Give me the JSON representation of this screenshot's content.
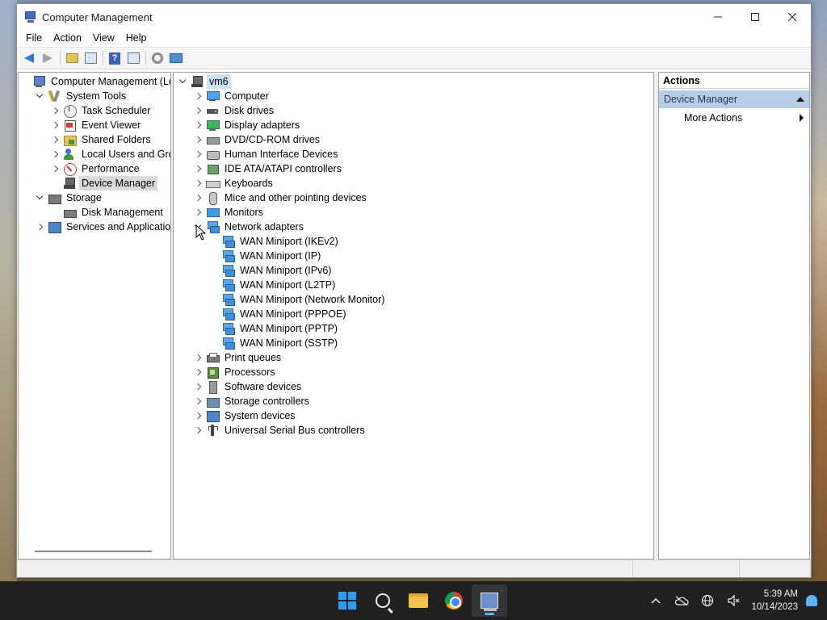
{
  "window": {
    "title": "Computer Management"
  },
  "menu": [
    "File",
    "Action",
    "View",
    "Help"
  ],
  "nav_tree": [
    {
      "name": "root",
      "label": "Computer Management (Local",
      "level": 0,
      "expander": "none",
      "icon": "computer-management-icon"
    },
    {
      "name": "system-tools",
      "label": "System Tools",
      "level": 1,
      "expander": "down",
      "icon": "tools-icon"
    },
    {
      "name": "task-scheduler",
      "label": "Task Scheduler",
      "level": 2,
      "expander": "right",
      "icon": "clock-icon"
    },
    {
      "name": "event-viewer",
      "label": "Event Viewer",
      "level": 2,
      "expander": "right",
      "icon": "event-viewer-icon"
    },
    {
      "name": "shared-folders",
      "label": "Shared Folders",
      "level": 2,
      "expander": "right",
      "icon": "shared-folder-icon"
    },
    {
      "name": "local-users-and-groups",
      "label": "Local Users and Groups",
      "level": 2,
      "expander": "right",
      "icon": "users-icon"
    },
    {
      "name": "performance",
      "label": "Performance",
      "level": 2,
      "expander": "right",
      "icon": "performance-icon"
    },
    {
      "name": "device-manager",
      "label": "Device Manager",
      "level": 2,
      "expander": "none",
      "icon": "device-manager-icon",
      "selected": true
    },
    {
      "name": "storage",
      "label": "Storage",
      "level": 1,
      "expander": "down",
      "icon": "storage-icon"
    },
    {
      "name": "disk-management",
      "label": "Disk Management",
      "level": 2,
      "expander": "none",
      "icon": "disk-management-icon"
    },
    {
      "name": "services-and-applications",
      "label": "Services and Applications",
      "level": 1,
      "expander": "right",
      "icon": "services-icon"
    }
  ],
  "device_tree": [
    {
      "name": "host",
      "label": "vm6",
      "level": 0,
      "expander": "down",
      "icon": "host-icon",
      "selected": true
    },
    {
      "name": "computer",
      "label": "Computer",
      "level": 1,
      "expander": "right",
      "icon": "computer-icon"
    },
    {
      "name": "disk-drives",
      "label": "Disk drives",
      "level": 1,
      "expander": "right",
      "icon": "disk-drive-icon"
    },
    {
      "name": "display-adapters",
      "label": "Display adapters",
      "level": 1,
      "expander": "right",
      "icon": "display-adapter-icon"
    },
    {
      "name": "dvd-cd-rom-drives",
      "label": "DVD/CD-ROM drives",
      "level": 1,
      "expander": "right",
      "icon": "dvd-drive-icon"
    },
    {
      "name": "human-interface-devices",
      "label": "Human Interface Devices",
      "level": 1,
      "expander": "right",
      "icon": "hid-icon"
    },
    {
      "name": "ide-ata-atapi-controllers",
      "label": "IDE ATA/ATAPI controllers",
      "level": 1,
      "expander": "right",
      "icon": "ide-controller-icon"
    },
    {
      "name": "keyboards",
      "label": "Keyboards",
      "level": 1,
      "expander": "right",
      "icon": "keyboard-icon"
    },
    {
      "name": "mice",
      "label": "Mice and other pointing devices",
      "level": 1,
      "expander": "right",
      "icon": "mouse-icon"
    },
    {
      "name": "monitors",
      "label": "Monitors",
      "level": 1,
      "expander": "right",
      "icon": "monitor-icon"
    },
    {
      "name": "network-adapters",
      "label": "Network adapters",
      "level": 1,
      "expander": "down",
      "icon": "network-adapter-icon"
    },
    {
      "name": "wan-ikev2",
      "label": "WAN Miniport (IKEv2)",
      "level": 2,
      "expander": "none",
      "icon": "network-adapter-icon"
    },
    {
      "name": "wan-ip",
      "label": "WAN Miniport (IP)",
      "level": 2,
      "expander": "none",
      "icon": "network-adapter-icon"
    },
    {
      "name": "wan-ipv6",
      "label": "WAN Miniport (IPv6)",
      "level": 2,
      "expander": "none",
      "icon": "network-adapter-icon"
    },
    {
      "name": "wan-l2tp",
      "label": "WAN Miniport (L2TP)",
      "level": 2,
      "expander": "none",
      "icon": "network-adapter-icon"
    },
    {
      "name": "wan-network-monitor",
      "label": "WAN Miniport (Network Monitor)",
      "level": 2,
      "expander": "none",
      "icon": "network-adapter-icon"
    },
    {
      "name": "wan-pppoe",
      "label": "WAN Miniport (PPPOE)",
      "level": 2,
      "expander": "none",
      "icon": "network-adapter-icon"
    },
    {
      "name": "wan-pptp",
      "label": "WAN Miniport (PPTP)",
      "level": 2,
      "expander": "none",
      "icon": "network-adapter-icon"
    },
    {
      "name": "wan-sstp",
      "label": "WAN Miniport (SSTP)",
      "level": 2,
      "expander": "none",
      "icon": "network-adapter-icon"
    },
    {
      "name": "print-queues",
      "label": "Print queues",
      "level": 1,
      "expander": "right",
      "icon": "printer-icon"
    },
    {
      "name": "processors",
      "label": "Processors",
      "level": 1,
      "expander": "right",
      "icon": "processor-icon"
    },
    {
      "name": "software-devices",
      "label": "Software devices",
      "level": 1,
      "expander": "right",
      "icon": "software-device-icon"
    },
    {
      "name": "storage-controllers",
      "label": "Storage controllers",
      "level": 1,
      "expander": "right",
      "icon": "storage-controller-icon"
    },
    {
      "name": "system-devices",
      "label": "System devices",
      "level": 1,
      "expander": "right",
      "icon": "system-device-icon"
    },
    {
      "name": "usb-controllers",
      "label": "Universal Serial Bus controllers",
      "level": 1,
      "expander": "right",
      "icon": "usb-icon"
    }
  ],
  "actions": {
    "header": "Actions",
    "section": "Device Manager",
    "items": [
      "More Actions"
    ]
  },
  "taskbar": {
    "clock_time": "5:39 AM",
    "clock_date": "10/14/2023"
  }
}
